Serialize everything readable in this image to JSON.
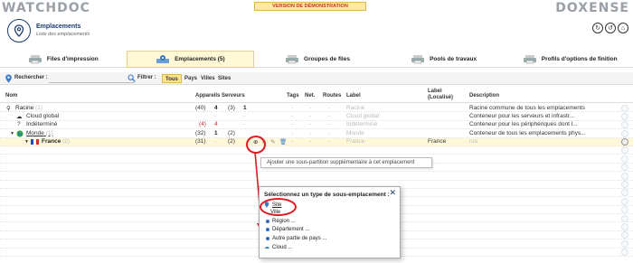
{
  "topbar": {
    "logo_left": "WATCHDOC",
    "logo_right": "DOXENSE",
    "demo_banner": "VERSION DE DÉMONSTRATION"
  },
  "header": {
    "title": "Emplacements",
    "subtitle": "Liste des emplacements"
  },
  "tabs": [
    {
      "label": "Files d'impression",
      "icon": "printer-icon"
    },
    {
      "label": "Emplacements (5)",
      "icon": "locations-icon",
      "active": true
    },
    {
      "label": "Groupes de files",
      "icon": "printer-group-icon"
    },
    {
      "label": "Pools de travaux",
      "icon": "pool-icon"
    },
    {
      "label": "Profils d'options de finition",
      "icon": "finishing-icon"
    }
  ],
  "search": {
    "label": "Rechercher :",
    "value": "",
    "placeholder": "",
    "filter_label": "Filtrer :",
    "chips": [
      {
        "label": "Tous",
        "active": true
      },
      {
        "label": "Pays"
      },
      {
        "label": "Villes"
      },
      {
        "label": "Sites"
      }
    ]
  },
  "columns": {
    "nom": "Nom",
    "appareils": "Appareils",
    "serveurs": "Serveurs",
    "tags": "Tags",
    "net": "Net.",
    "routes": "Routes",
    "label": "Label",
    "label_local": "Label (Localisé)",
    "description": "Description"
  },
  "rows": [
    {
      "name": "Racine",
      "count": "(1)",
      "app": "(40)",
      "app2": "4",
      "srv": "(3)",
      "srv2": "1",
      "tags": "-",
      "net": "-",
      "routes": "-",
      "label": "Racine",
      "label_local": "",
      "desc": "Racine commune de tous les emplacements"
    },
    {
      "name": "Cloud global",
      "count": "",
      "app": "",
      "app2": "-",
      "srv": "",
      "srv2": "-",
      "tags": "-",
      "net": "-",
      "routes": "-",
      "label": "Cloud global",
      "label_local": "",
      "desc": "Conteneur pour les serveurs et infrastr..."
    },
    {
      "name": "Indéterminé",
      "count": "",
      "app": "(4)",
      "app2": "4",
      "srv": "",
      "srv2": "-",
      "tags": "-",
      "net": "-",
      "routes": "-",
      "label": "Indéterminé",
      "label_local": "",
      "desc": "Conteneur pour les périphériques dont l..."
    },
    {
      "name": "Monde",
      "count": "(1)",
      "app": "(32)",
      "app2": "1",
      "srv": "(2)",
      "srv2": "",
      "tags": "-",
      "net": "-",
      "routes": "-",
      "label": "Monde",
      "label_local": "",
      "desc": "Conteneur de tous les emplacements phys..."
    },
    {
      "name": "France",
      "count": "(2)",
      "app": "(31)",
      "app2": "-",
      "srv": "(2)",
      "srv2": "",
      "tags": "-",
      "net": "-",
      "routes": "-",
      "label": "France",
      "label_local": "France",
      "desc": "n/a"
    }
  ],
  "tooltip": "Ajouter une sous-partition supplémentaire à cet emplacement",
  "popup": {
    "title": "Sélectionnez un type de sous-emplacement :",
    "options": [
      {
        "label": "Site",
        "icon": "site-pin-icon"
      },
      {
        "label": "Ville",
        "icon": "dot-icon"
      },
      {
        "label": "Région ...",
        "icon": "dot-icon"
      },
      {
        "label": "Département ...",
        "icon": "dot-icon"
      },
      {
        "label": "Autre partie de pays ...",
        "icon": "dot-icon"
      },
      {
        "label": "Cloud ...",
        "icon": "cloud-icon"
      }
    ]
  }
}
